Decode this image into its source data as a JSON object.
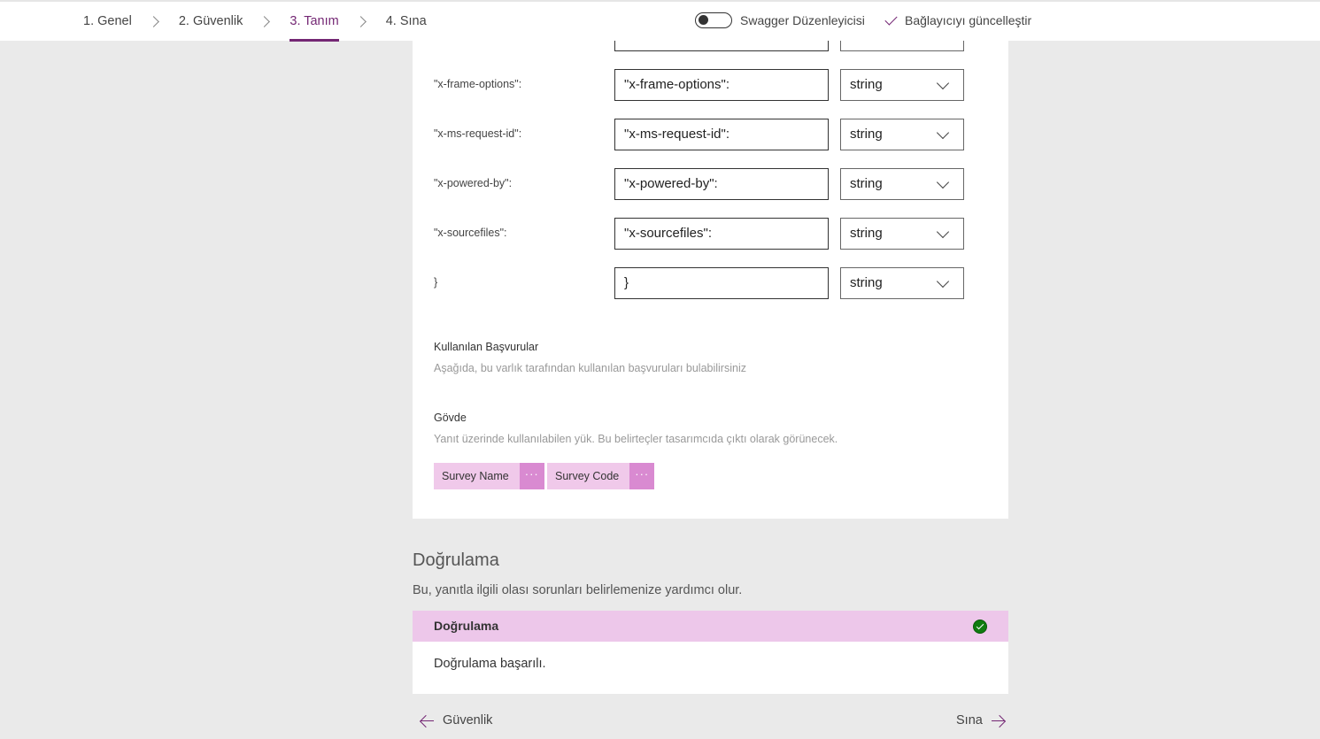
{
  "wizard": {
    "steps": [
      {
        "label": "1. Genel"
      },
      {
        "label": "2. Güvenlik"
      },
      {
        "label": "3. Tanım"
      },
      {
        "label": "4. Sına"
      }
    ],
    "active_step": "3. Tanım",
    "swagger_toggle": {
      "label": "Swagger Düzenleyicisi",
      "on": false
    },
    "update_connector_label": "Bağlayıcıyı güncelleştir",
    "accent_color": "#742774"
  },
  "headers": {
    "rows": [
      {
        "key": "\"x-frame-options\":",
        "value": "\"x-frame-options\":",
        "type": "string"
      },
      {
        "key": "\"x-ms-request-id\":",
        "value": "\"x-ms-request-id\":",
        "type": "string"
      },
      {
        "key": "\"x-powered-by\":",
        "value": "\"x-powered-by\":",
        "type": "string"
      },
      {
        "key": "\"x-sourcefiles\":",
        "value": "\"x-sourcefiles\":",
        "type": "string"
      },
      {
        "key": "}",
        "value": "}",
        "type": "string"
      }
    ]
  },
  "references": {
    "title": "Kullanılan Başvurular",
    "description": "Aşağıda, bu varlık tarafından kullanılan başvuruları bulabilirsiniz"
  },
  "body": {
    "title": "Gövde",
    "description": "Yanıt üzerinde kullanılabilen yük. Bu belirteçler tasarımcıda çıktı olarak görünecek.",
    "chips": [
      {
        "label": "Survey Name",
        "more": "···"
      },
      {
        "label": "Survey Code",
        "more": "···"
      }
    ]
  },
  "validation": {
    "title": "Doğrulama",
    "description": "Bu, yanıtla ilgili olası sorunları belirlemenize yardımcı olur.",
    "header": "Doğrulama",
    "status_color": "#107c10",
    "message": "Doğrulama başarılı."
  },
  "navigation": {
    "back_label": "Güvenlik",
    "next_label": "Sına"
  }
}
